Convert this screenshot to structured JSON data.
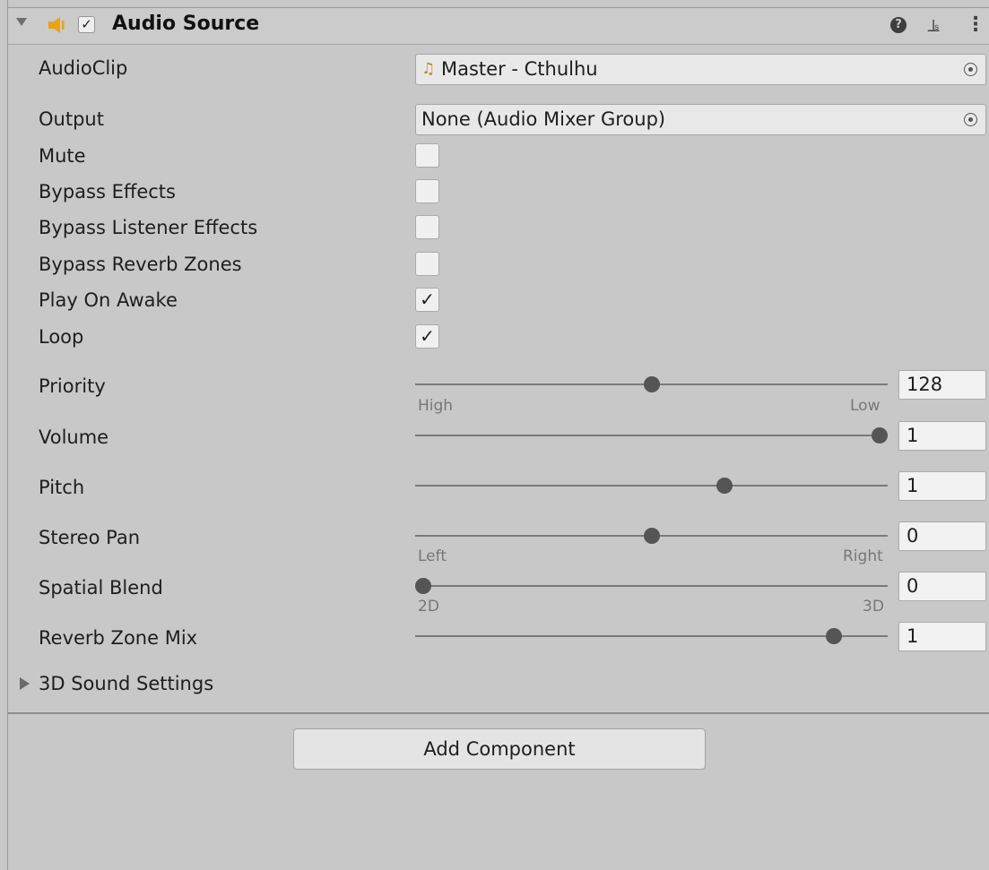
{
  "header": {
    "title": "Audio Source",
    "enabled": true,
    "icons": [
      "foldout-arrow-icon",
      "audio-source-icon",
      "help-icon",
      "presets-icon",
      "context-menu-icon"
    ],
    "help_glyph": "?",
    "presets_glyph": "⫡",
    "menu_glyph": "⋮"
  },
  "fields": {
    "audioclip": {
      "label": "AudioClip",
      "value": "Master - Cthulhu",
      "icon": "music-note-icon"
    },
    "output": {
      "label": "Output",
      "value": "None (Audio Mixer Group)"
    },
    "mute": {
      "label": "Mute",
      "checked": false
    },
    "bypass_effects": {
      "label": "Bypass Effects",
      "checked": false
    },
    "bypass_listener_effects": {
      "label": "Bypass Listener Effects",
      "checked": false
    },
    "bypass_reverb_zones": {
      "label": "Bypass Reverb Zones",
      "checked": false
    },
    "play_on_awake": {
      "label": "Play On Awake",
      "checked": true,
      "mark": "✓"
    },
    "loop": {
      "label": "Loop",
      "checked": true,
      "mark": "✓"
    }
  },
  "sliders": {
    "priority": {
      "label": "Priority",
      "value": "128",
      "fraction": 0.5,
      "left": "High",
      "right": "Low"
    },
    "volume": {
      "label": "Volume",
      "value": "1",
      "fraction": 1.0
    },
    "pitch": {
      "label": "Pitch",
      "value": "1",
      "fraction": 0.66
    },
    "stereo_pan": {
      "label": "Stereo Pan",
      "value": "0",
      "fraction": 0.5,
      "left": "Left",
      "right": "Right"
    },
    "spatial_blend": {
      "label": "Spatial Blend",
      "value": "0",
      "fraction": 0.0,
      "left": "2D",
      "right": "3D"
    },
    "reverb_zone_mix": {
      "label": "Reverb Zone Mix",
      "value": "1",
      "fraction": 0.9
    }
  },
  "foldout_3d": {
    "label": "3D Sound Settings"
  },
  "add_component": {
    "label": "Add Component"
  },
  "colors": {
    "background": "#c8c8c8",
    "icon_accent": "#e8a317",
    "slider_thumb": "#555555"
  }
}
